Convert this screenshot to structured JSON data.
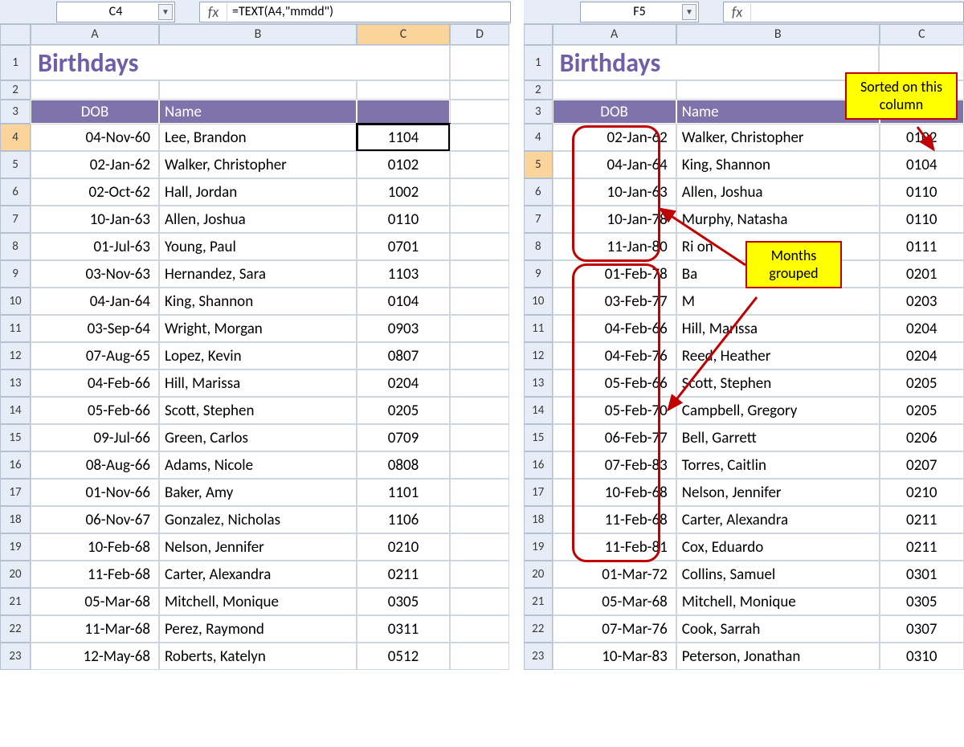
{
  "left": {
    "namebox": "C4",
    "fx_label": "fx",
    "formula": "=TEXT(A4,\"mmdd\")",
    "cols": [
      "A",
      "B",
      "C",
      "D"
    ],
    "selected_col": "C",
    "selected_rownum": 4,
    "title": "Birthdays",
    "headers": {
      "dob": "DOB",
      "name": "Name"
    },
    "rows": [
      {
        "n": 4,
        "dob": "04-Nov-60",
        "name": "Lee, Brandon",
        "c": "1104",
        "active": true
      },
      {
        "n": 5,
        "dob": "02-Jan-62",
        "name": "Walker, Christopher",
        "c": "0102"
      },
      {
        "n": 6,
        "dob": "02-Oct-62",
        "name": "Hall, Jordan",
        "c": "1002"
      },
      {
        "n": 7,
        "dob": "10-Jan-63",
        "name": "Allen, Joshua",
        "c": "0110"
      },
      {
        "n": 8,
        "dob": "01-Jul-63",
        "name": "Young, Paul",
        "c": "0701"
      },
      {
        "n": 9,
        "dob": "03-Nov-63",
        "name": "Hernandez, Sara",
        "c": "1103"
      },
      {
        "n": 10,
        "dob": "04-Jan-64",
        "name": "King, Shannon",
        "c": "0104"
      },
      {
        "n": 11,
        "dob": "03-Sep-64",
        "name": "Wright, Morgan",
        "c": "0903"
      },
      {
        "n": 12,
        "dob": "07-Aug-65",
        "name": "Lopez, Kevin",
        "c": "0807"
      },
      {
        "n": 13,
        "dob": "04-Feb-66",
        "name": "Hill, Marissa",
        "c": "0204"
      },
      {
        "n": 14,
        "dob": "05-Feb-66",
        "name": "Scott, Stephen",
        "c": "0205"
      },
      {
        "n": 15,
        "dob": "09-Jul-66",
        "name": "Green, Carlos",
        "c": "0709"
      },
      {
        "n": 16,
        "dob": "08-Aug-66",
        "name": "Adams, Nicole",
        "c": "0808"
      },
      {
        "n": 17,
        "dob": "01-Nov-66",
        "name": "Baker, Amy",
        "c": "1101"
      },
      {
        "n": 18,
        "dob": "06-Nov-67",
        "name": "Gonzalez, Nicholas",
        "c": "1106"
      },
      {
        "n": 19,
        "dob": "10-Feb-68",
        "name": "Nelson, Jennifer",
        "c": "0210"
      },
      {
        "n": 20,
        "dob": "11-Feb-68",
        "name": "Carter, Alexandra",
        "c": "0211"
      },
      {
        "n": 21,
        "dob": "05-Mar-68",
        "name": "Mitchell, Monique",
        "c": "0305"
      },
      {
        "n": 22,
        "dob": "11-Mar-68",
        "name": "Perez, Raymond",
        "c": "0311"
      },
      {
        "n": 23,
        "dob": "12-May-68",
        "name": "Roberts, Katelyn",
        "c": "0512"
      }
    ]
  },
  "right": {
    "namebox": "F5",
    "fx_label": "fx",
    "formula": "",
    "cols": [
      "A",
      "B",
      "C"
    ],
    "selected_rownum": 5,
    "title": "Birthdays",
    "headers": {
      "dob": "DOB",
      "name": "Name"
    },
    "callout_sorted": "Sorted on this column",
    "callout_months": "Months grouped",
    "rows": [
      {
        "n": 4,
        "dob": "02-Jan-62",
        "name": "Walker, Christopher",
        "c": "0102"
      },
      {
        "n": 5,
        "dob": "04-Jan-64",
        "name": "King, Shannon",
        "c": "0104"
      },
      {
        "n": 6,
        "dob": "10-Jan-63",
        "name": "Allen, Joshua",
        "c": "0110"
      },
      {
        "n": 7,
        "dob": "10-Jan-78",
        "name": "Murphy, Natasha",
        "c": "0110"
      },
      {
        "n": 8,
        "dob": "11-Jan-80",
        "name": "Ri                      on",
        "c": "0111"
      },
      {
        "n": 9,
        "dob": "01-Feb-78",
        "name": "Ba",
        "c": "0201"
      },
      {
        "n": 10,
        "dob": "03-Feb-77",
        "name": "M",
        "c": "0203"
      },
      {
        "n": 11,
        "dob": "04-Feb-66",
        "name": "Hill, Marissa",
        "c": "0204"
      },
      {
        "n": 12,
        "dob": "04-Feb-76",
        "name": "Reed, Heather",
        "c": "0204"
      },
      {
        "n": 13,
        "dob": "05-Feb-66",
        "name": "Scott, Stephen",
        "c": "0205"
      },
      {
        "n": 14,
        "dob": "05-Feb-70",
        "name": "Campbell, Gregory",
        "c": "0205"
      },
      {
        "n": 15,
        "dob": "06-Feb-77",
        "name": "Bell, Garrett",
        "c": "0206"
      },
      {
        "n": 16,
        "dob": "07-Feb-83",
        "name": "Torres, Caitlin",
        "c": "0207"
      },
      {
        "n": 17,
        "dob": "10-Feb-68",
        "name": "Nelson, Jennifer",
        "c": "0210"
      },
      {
        "n": 18,
        "dob": "11-Feb-68",
        "name": "Carter, Alexandra",
        "c": "0211"
      },
      {
        "n": 19,
        "dob": "11-Feb-81",
        "name": "Cox, Eduardo",
        "c": "0211"
      },
      {
        "n": 20,
        "dob": "01-Mar-72",
        "name": "Collins, Samuel",
        "c": "0301"
      },
      {
        "n": 21,
        "dob": "05-Mar-68",
        "name": "Mitchell, Monique",
        "c": "0305"
      },
      {
        "n": 22,
        "dob": "07-Mar-76",
        "name": "Cook, Sarrah",
        "c": "0307"
      },
      {
        "n": 23,
        "dob": "10-Mar-83",
        "name": "Peterson, Jonathan",
        "c": "0310"
      }
    ]
  }
}
